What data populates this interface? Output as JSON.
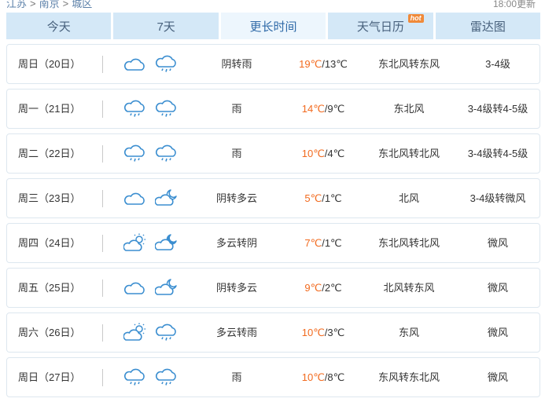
{
  "breadcrumb": [
    "江苏",
    "南京",
    "城区"
  ],
  "updated": "18:00更新",
  "tabs": [
    {
      "label": "今天",
      "active": false
    },
    {
      "label": "7天",
      "active": false
    },
    {
      "label": "更长时间",
      "active": true
    },
    {
      "label": "天气日历",
      "active": false,
      "badge": "hot"
    },
    {
      "label": "雷达图",
      "active": false
    }
  ],
  "rows": [
    {
      "day": "周日（20日）",
      "icons": [
        "cloudy-icon",
        "rain-icon"
      ],
      "desc": "阴转雨",
      "hi": "19℃",
      "lo": "13℃",
      "wind": "东北风转东风",
      "level": "3-4级"
    },
    {
      "day": "周一（21日）",
      "icons": [
        "rain-icon",
        "rain-icon"
      ],
      "desc": "雨",
      "hi": "14℃",
      "lo": "9℃",
      "wind": "东北风",
      "level": "3-4级转4-5级"
    },
    {
      "day": "周二（22日）",
      "icons": [
        "rain-icon",
        "rain-icon"
      ],
      "desc": "雨",
      "hi": "10℃",
      "lo": "4℃",
      "wind": "东北风转北风",
      "level": "3-4级转4-5级"
    },
    {
      "day": "周三（23日）",
      "icons": [
        "cloudy-icon",
        "moon-cloud-icon"
      ],
      "desc": "阴转多云",
      "hi": "5℃",
      "lo": "1℃",
      "wind": "北风",
      "level": "3-4级转微风"
    },
    {
      "day": "周四（24日）",
      "icons": [
        "sun-cloud-icon",
        "moon-overcast-icon"
      ],
      "desc": "多云转阴",
      "hi": "7℃",
      "lo": "1℃",
      "wind": "东北风转北风",
      "level": "微风"
    },
    {
      "day": "周五（25日）",
      "icons": [
        "cloudy-icon",
        "moon-cloud-icon"
      ],
      "desc": "阴转多云",
      "hi": "9℃",
      "lo": "2℃",
      "wind": "北风转东风",
      "level": "微风"
    },
    {
      "day": "周六（26日）",
      "icons": [
        "sun-cloud-icon",
        "rain-icon"
      ],
      "desc": "多云转雨",
      "hi": "10℃",
      "lo": "3℃",
      "wind": "东风",
      "level": "微风"
    },
    {
      "day": "周日（27日）",
      "icons": [
        "rain-icon",
        "rain-icon"
      ],
      "desc": "雨",
      "hi": "10℃",
      "lo": "8℃",
      "wind": "东风转东北风",
      "level": "微风"
    }
  ]
}
